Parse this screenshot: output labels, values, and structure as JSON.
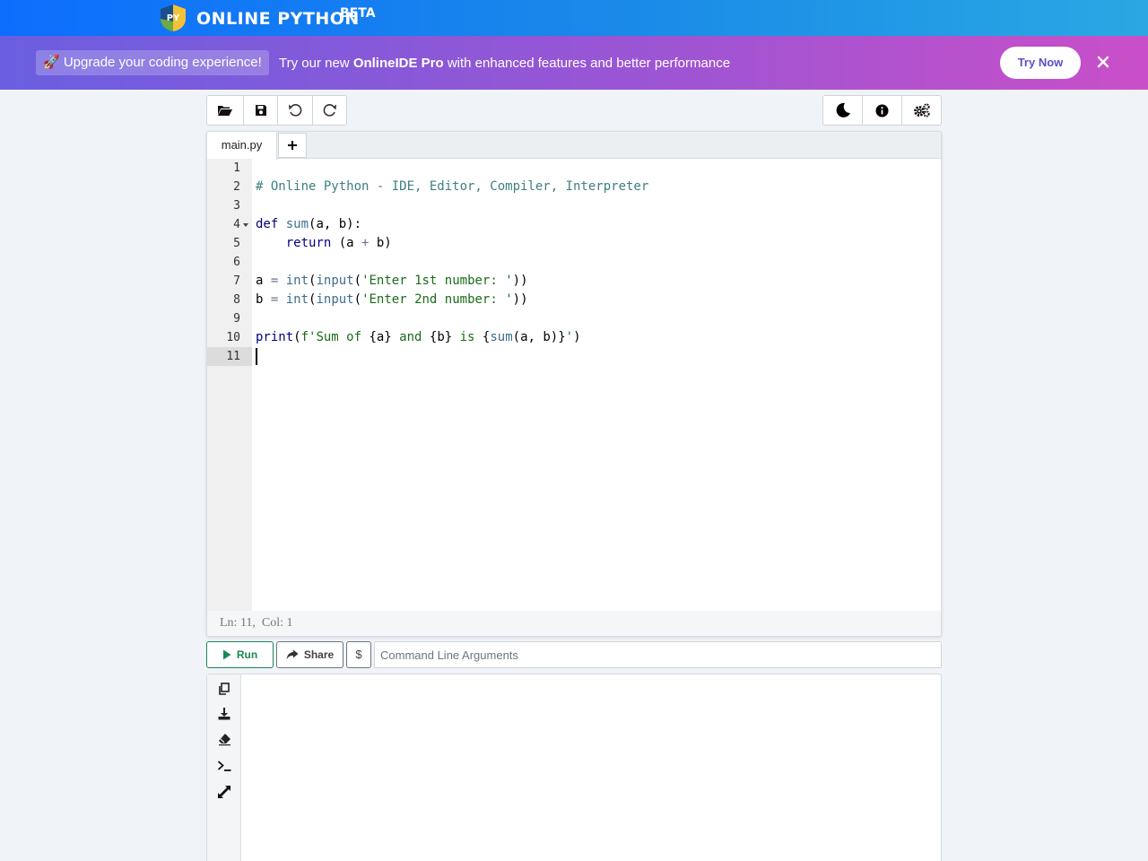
{
  "header": {
    "brand": "ONLINE PYTHON",
    "beta": "BETA",
    "logo_text": "PY"
  },
  "banner": {
    "upgrade_label": "🚀 Upgrade your coding experience!",
    "promo_prefix": "Try our new ",
    "promo_product": "OnlineIDE Pro",
    "promo_suffix": " with enhanced features and better performance",
    "try_now_label": "Try Now",
    "close_icon": "close-icon"
  },
  "toolbar_left": [
    "open-folder-icon",
    "save-icon",
    "undo-icon",
    "redo-icon"
  ],
  "toolbar_right": [
    "moon-icon",
    "info-icon",
    "settings-icon"
  ],
  "editor": {
    "tab_name": "main.py",
    "add_tab": "+",
    "line_numbers": [
      "1",
      "2",
      "3",
      "4",
      "5",
      "6",
      "7",
      "8",
      "9",
      "10",
      "11"
    ],
    "status": "Ln: 11,  Col: 1"
  },
  "actions": {
    "run_label": "Run",
    "share_label": "Share",
    "dollar_label": "$",
    "args_placeholder": "Command Line Arguments"
  },
  "output_toolbar": [
    "copy-icon",
    "download-icon",
    "eraser-icon",
    "terminal-icon",
    "expand-icon"
  ],
  "colors": {
    "header": "#0d6efd",
    "banner_start": "#6a5fe0",
    "banner_end": "#c94fc8",
    "run_green": "#198754"
  }
}
